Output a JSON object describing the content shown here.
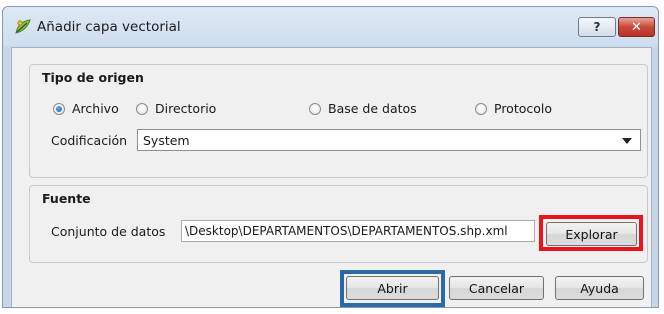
{
  "window": {
    "title": "Añadir capa vectorial",
    "help_glyph": "?",
    "close_glyph": "✕"
  },
  "source_type": {
    "heading": "Tipo de origen",
    "options": [
      {
        "label": "Archivo",
        "checked": true
      },
      {
        "label": "Directorio",
        "checked": false
      },
      {
        "label": "Base de datos",
        "checked": false
      },
      {
        "label": "Protocolo",
        "checked": false
      }
    ],
    "encoding_label": "Codificación",
    "encoding_value": "System"
  },
  "source": {
    "heading": "Fuente",
    "dataset_label": "Conjunto de datos",
    "dataset_value": "\\Desktop\\DEPARTAMENTOS\\DEPARTAMENTOS.shp.xml",
    "browse_label": "Explorar"
  },
  "footer": {
    "open_label": "Abrir",
    "cancel_label": "Cancelar",
    "help_label": "Ayuda"
  },
  "colors": {
    "highlight_red": "#e8151d",
    "highlight_blue": "#2b69a8"
  },
  "icons": {
    "app": "qgis-icon"
  }
}
